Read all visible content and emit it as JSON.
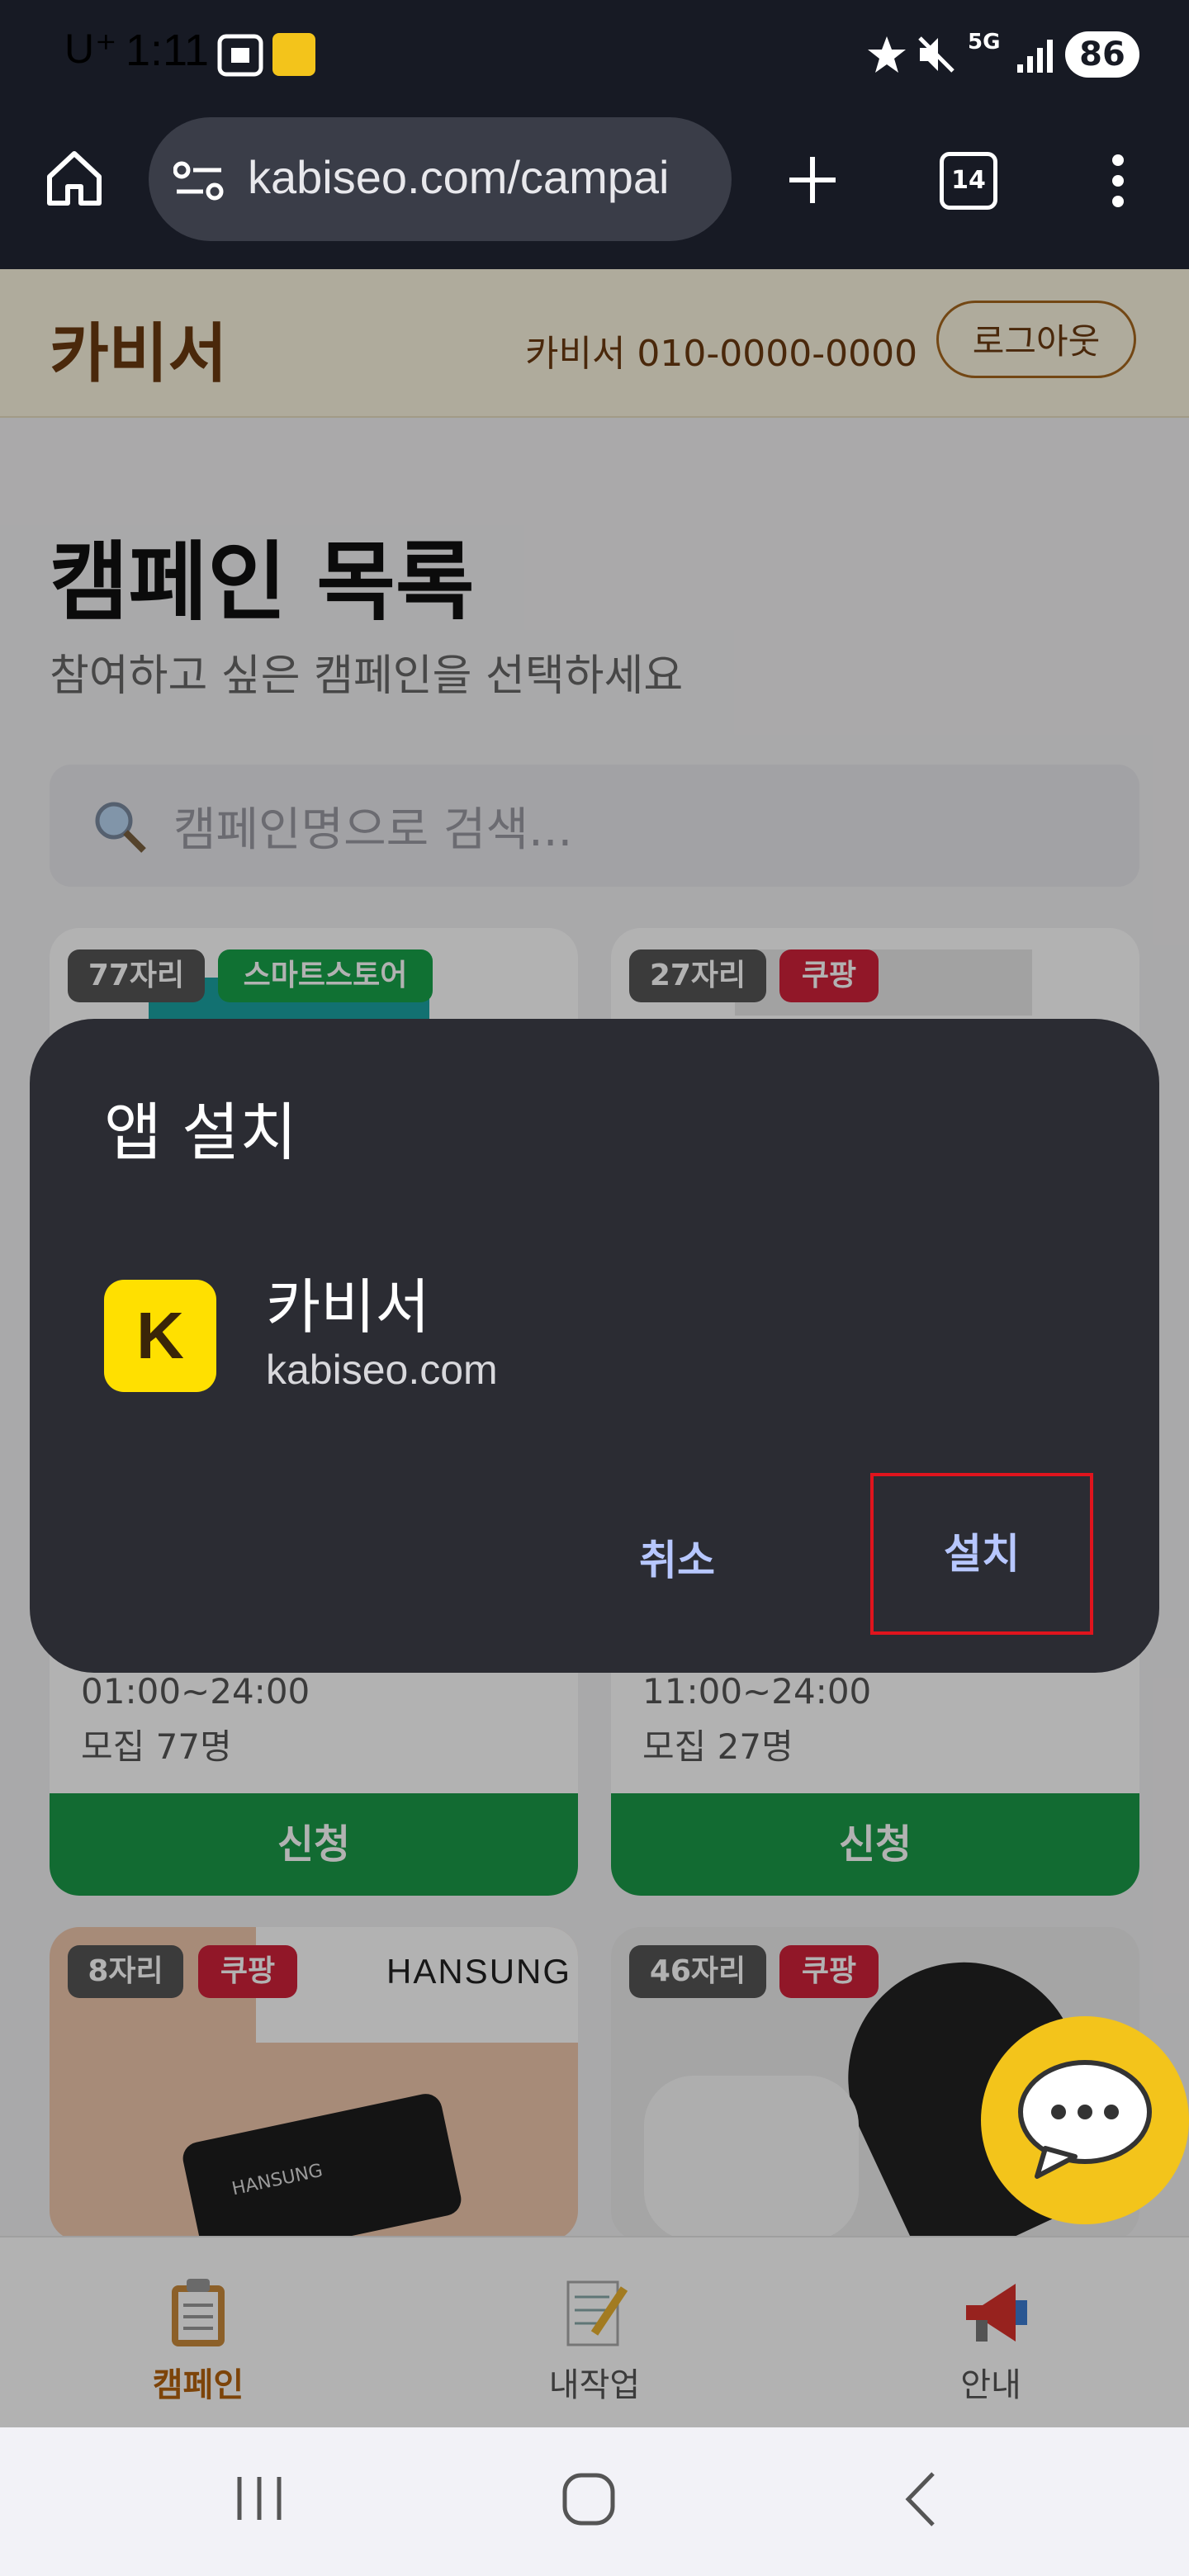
{
  "status_bar": {
    "carrier": "U⁺",
    "time": "1:11",
    "network": "5G",
    "battery": "86"
  },
  "browser": {
    "url": "kabiseo.com/campai",
    "tab_count": "14"
  },
  "site_header": {
    "logo": "카비서",
    "contact": "카비서 010-0000-0000",
    "logout_label": "로그아웃"
  },
  "page": {
    "title": "캠페인 목록",
    "subtitle": "참여하고 싶은 캠페인을 선택하세요",
    "search_placeholder": "캠페인명으로 검색..."
  },
  "cards": [
    {
      "slots": "77자리",
      "platform": "스마트스토어",
      "hours": "01:00~24:00",
      "recruit": "모집 77명",
      "apply": "신청"
    },
    {
      "slots": "27자리",
      "platform": "쿠팡",
      "hours": "11:00~24:00",
      "recruit": "모집 27명",
      "apply": "신청"
    },
    {
      "slots": "8자리",
      "platform": "쿠팡",
      "brand": "HANSUNG"
    },
    {
      "slots": "46자리",
      "platform": "쿠팡"
    }
  ],
  "bottom_nav": [
    {
      "label": "캠페인",
      "icon": "clipboard-icon",
      "active": true
    },
    {
      "label": "내작업",
      "icon": "memo-icon",
      "active": false
    },
    {
      "label": "안내",
      "icon": "megaphone-icon",
      "active": false
    }
  ],
  "dialog": {
    "title": "앱 설치",
    "app_name": "카비서",
    "app_domain": "kabiseo.com",
    "app_icon_letter": "K",
    "cancel_label": "취소",
    "install_label": "설치"
  },
  "colors": {
    "accent_brown": "#6a3a10",
    "apply_green": "#1a9a48",
    "dialog_bg": "#2b2c33",
    "dialog_button_text": "#b7c7ff",
    "highlight_red": "#e0141d",
    "app_icon_yellow": "#ffe000"
  }
}
